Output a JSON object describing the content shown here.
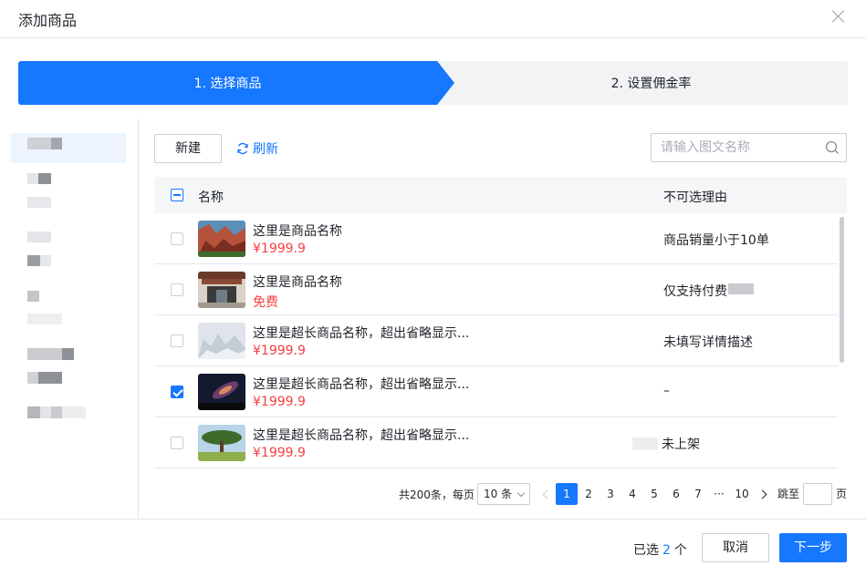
{
  "dialog": {
    "title": "添加商品"
  },
  "steps": [
    {
      "label": "1. 选择商品"
    },
    {
      "label": "2. 设置佣金率"
    }
  ],
  "toolbar": {
    "new_label": "新建",
    "refresh_label": "刷新"
  },
  "search": {
    "placeholder": "请输入图文名称",
    "value": ""
  },
  "table": {
    "columns": {
      "name": "名称",
      "reason": "不可选理由"
    },
    "rows": [
      {
        "name": "这里是商品名称",
        "price": "¥1999.9",
        "reason": "商品销量小于10单",
        "checked": false,
        "thumb": "canyon"
      },
      {
        "name": "这里是商品名称",
        "price": "免费",
        "reason": "仅支持付费",
        "checked": false,
        "thumb": "temple"
      },
      {
        "name": "这里是超长商品名称，超出省略显示...",
        "price": "¥1999.9",
        "reason": "未填写详情描述",
        "checked": false,
        "thumb": "snow"
      },
      {
        "name": "这里是超长商品名称，超出省略显示...",
        "price": "¥1999.9",
        "reason": "–",
        "checked": true,
        "thumb": "night"
      },
      {
        "name": "这里是超长商品名称，超出省略显示...",
        "price": "¥1999.9",
        "reason": "未上架",
        "checked": false,
        "thumb": "tree"
      }
    ]
  },
  "pagination": {
    "total_label": "共200条，每页",
    "page_size": "10 条",
    "pages": [
      "1",
      "2",
      "3",
      "4",
      "5",
      "6",
      "7",
      "···",
      "10"
    ],
    "current": "1",
    "jump_label": "跳至",
    "page_suffix": "页"
  },
  "footer": {
    "selected_prefix": "已选",
    "selected_count": "2",
    "selected_suffix": "个",
    "cancel_label": "取消",
    "next_label": "下一步"
  },
  "colors": {
    "primary": "#1677ff",
    "price": "#f53f3f"
  }
}
